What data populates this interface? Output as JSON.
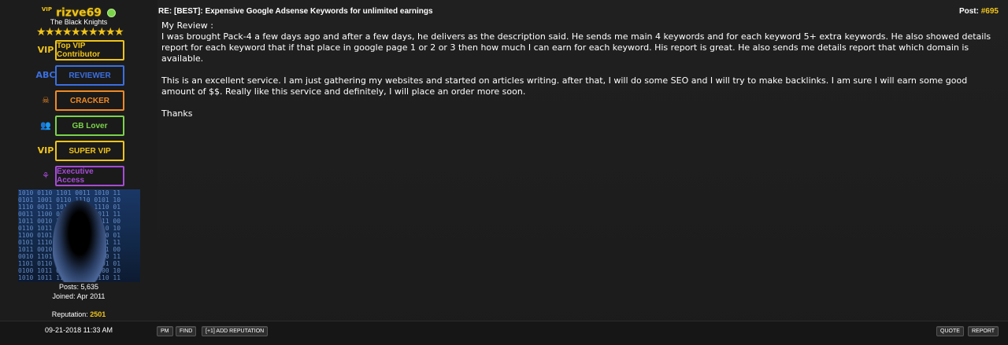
{
  "user": {
    "vip_tag": "VIP",
    "name": "rizve69",
    "group": "The Black Knights",
    "stars": 10,
    "awards": [
      {
        "icon": "VIP",
        "label": "Top VIP Contributor",
        "color": "#f0c419"
      },
      {
        "icon": "ABC",
        "label": "REVIEWER",
        "color": "#3b6fe0"
      },
      {
        "icon": "☠",
        "label": "CRACKER",
        "color": "#f08a24"
      },
      {
        "icon": "👥",
        "label": "GB Lover",
        "color": "#7bd34a"
      },
      {
        "icon": "VIP",
        "label": "SUPER VIP",
        "color": "#f0c419"
      },
      {
        "icon": "⚘",
        "label": "Executive Access",
        "color": "#a64bd6"
      }
    ],
    "posts": "Posts: 5,635",
    "joined": "Joined: Apr 2011",
    "reputation_label": "Reputation:",
    "reputation_value": "2501"
  },
  "post": {
    "title": "RE: [BEST]: Expensive Google Adsense Keywords for unlimited earnings",
    "number_label": "Post:",
    "number": "#695",
    "body": {
      "line1": "My Review :",
      "para1": "I was brought Pack-4 a few days ago and after a few days, he delivers as the description said. He sends me main 4 keywords and for each keyword 5+ extra keywords. He also showed details report for each keyword that if that place in google page 1 or 2 or 3 then how much I can earn for each keyword. His report is great. He also sends me details report that which domain is available.",
      "para2": "This is an excellent service. I am just gathering my websites and started on articles writing. after that, I will do some SEO and I will try to make backlinks. I am sure I will earn some good amount of $$. Really like this service and definitely, I will place an order more soon.",
      "thanks": "Thanks"
    }
  },
  "footer": {
    "date": "09-21-2018 11:33 AM",
    "pm": "PM",
    "find": "FIND",
    "add_rep": "[+1] ADD REPUTATION",
    "quote": "QUOTE",
    "report": "REPORT"
  }
}
